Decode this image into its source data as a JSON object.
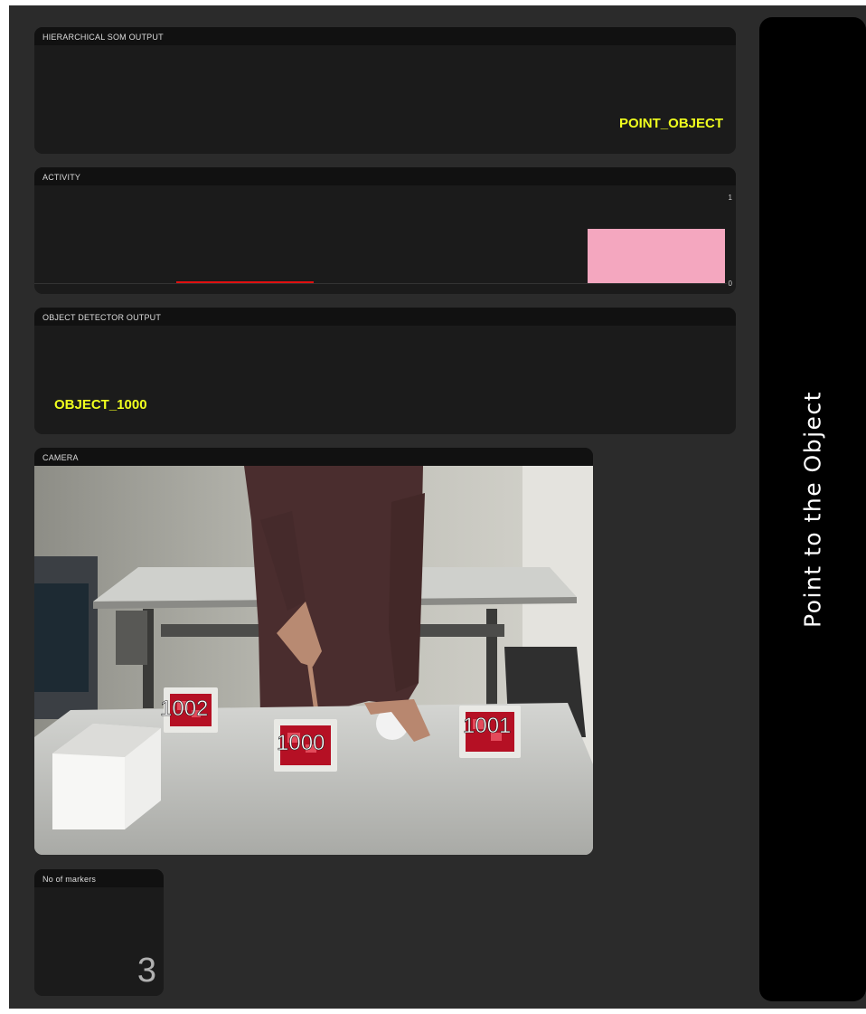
{
  "som_panel": {
    "title": "HIERARCHICAL SOM OUTPUT",
    "value": "POINT_OBJECT"
  },
  "activity_panel": {
    "title": "ACTIVITY",
    "y_max_label": "1",
    "y_min_label": "0",
    "bar_level": 0.6,
    "bar_color": "#f4a7bf",
    "line_color": "#e01010"
  },
  "detector_panel": {
    "title": "OBJECT DETECTOR OUTPUT",
    "value": "OBJECT_1000"
  },
  "camera_panel": {
    "title": "CAMERA",
    "markers": [
      "1002",
      "1000",
      "1001"
    ]
  },
  "markers_panel": {
    "title": "No of markers",
    "count": "3"
  },
  "instruction": {
    "text": "Point to the Object"
  },
  "colors": {
    "accent_yellow": "#f0ff1e",
    "panel_bg": "#1b1b1b",
    "app_bg": "#2b2b2b"
  }
}
